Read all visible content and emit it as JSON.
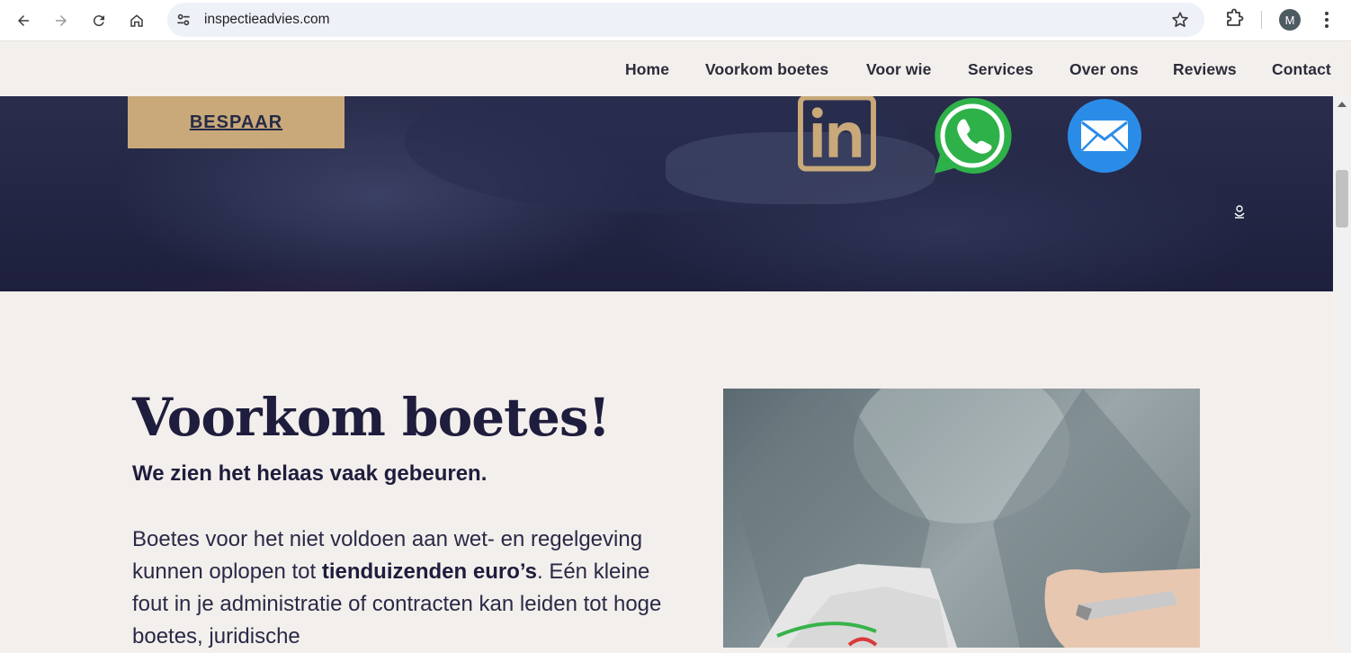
{
  "browser": {
    "url": "inspectieadvies.com",
    "profile_initial": "M"
  },
  "nav": {
    "items": [
      "Home",
      "Voorkom boetes",
      "Voor wie",
      "Services",
      "Over ons",
      "Reviews",
      "Contact"
    ]
  },
  "hero": {
    "cta_label": "BESPAAR",
    "social_icons": [
      "linkedin-icon",
      "whatsapp-icon",
      "mail-icon"
    ],
    "colors": {
      "cta": "#c9a97a",
      "background": "#232644",
      "whatsapp": "#2fb14a",
      "mail": "#2b8ce8",
      "linkedin": "#c9a97a"
    }
  },
  "content": {
    "title": "Voorkom boetes!",
    "subtitle": "We zien het helaas vaak gebeuren.",
    "para_part1": "Boetes voor het niet voldoen aan wet- en regelgeving kunnen oplopen tot ",
    "para_bold": "tienduizenden euro’s",
    "para_part2": ". Eén kleine fout in je administratie of contracten kan leiden tot hoge boetes, juridische"
  }
}
